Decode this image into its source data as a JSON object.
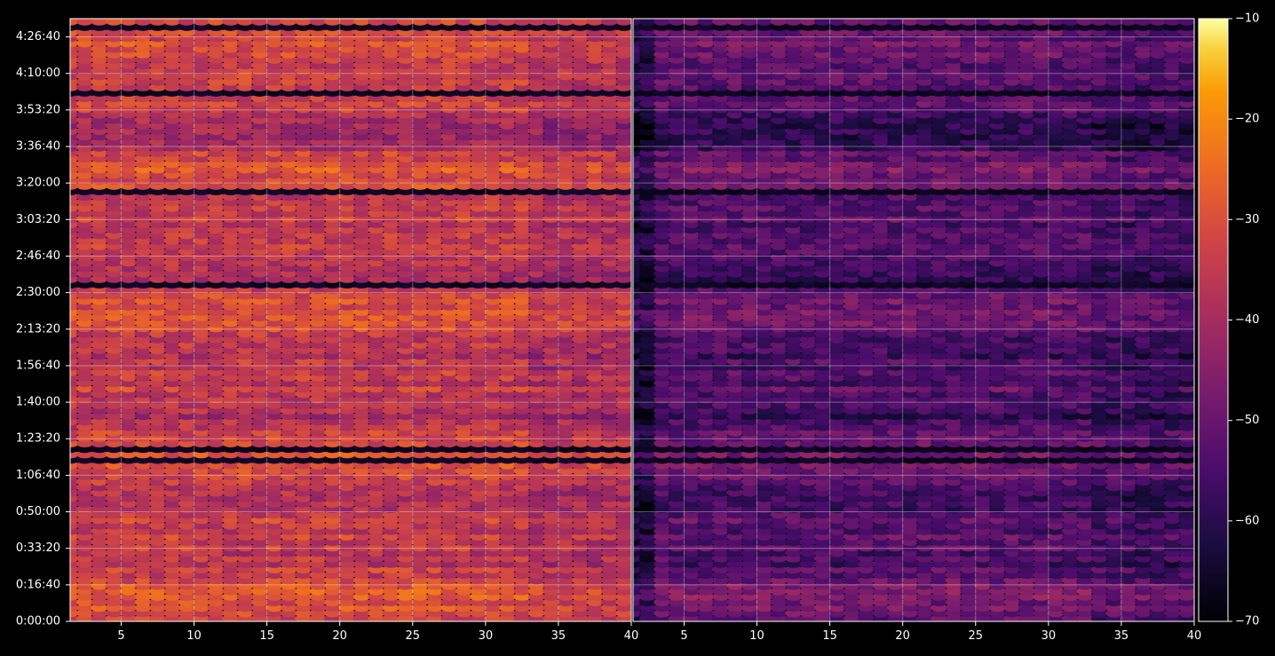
{
  "chart_data": {
    "type": "heatmap",
    "title": "",
    "colormap": "inferno",
    "background_color": "#000000",
    "text_color": "#ffffff",
    "grid": true,
    "panels": [
      {
        "name": "left",
        "xlim": [
          1.5,
          40
        ],
        "x_ticks": [
          5,
          10,
          15,
          20,
          25,
          30,
          35,
          40
        ],
        "x_tick_labels": [
          "5",
          "10",
          "15",
          "20",
          "25",
          "30",
          "35",
          "40"
        ],
        "channels": 39,
        "intensity": "high"
      },
      {
        "name": "right",
        "xlim": [
          1.5,
          40
        ],
        "x_ticks": [
          5,
          10,
          15,
          20,
          25,
          30,
          35,
          40
        ],
        "x_tick_labels": [
          "5",
          "10",
          "15",
          "20",
          "25",
          "30",
          "35",
          "40"
        ],
        "channels": 39,
        "intensity": "low"
      }
    ],
    "y_seconds_range": [
      0,
      16500
    ],
    "y_ticks_seconds": [
      0,
      1000,
      2000,
      3000,
      4000,
      5000,
      6000,
      7000,
      8000,
      9000,
      10000,
      11000,
      12000,
      13000,
      14000,
      15000,
      16000
    ],
    "y_tick_labels": [
      "0:00:00",
      "0:16:40",
      "0:33:20",
      "0:50:00",
      "1:06:40",
      "1:23:20",
      "1:40:00",
      "1:56:40",
      "2:13:20",
      "2:30:00",
      "2:46:40",
      "3:03:20",
      "3:20:00",
      "3:36:40",
      "3:53:20",
      "4:10:00",
      "4:26:40"
    ],
    "colorbar": {
      "range": [
        -70,
        -10
      ],
      "ticks": [
        -70,
        -60,
        -50,
        -40,
        -30,
        -20,
        -10
      ],
      "tick_labels": [
        "−70",
        "−60",
        "−50",
        "−40",
        "−30",
        "−20",
        "−10"
      ]
    }
  }
}
